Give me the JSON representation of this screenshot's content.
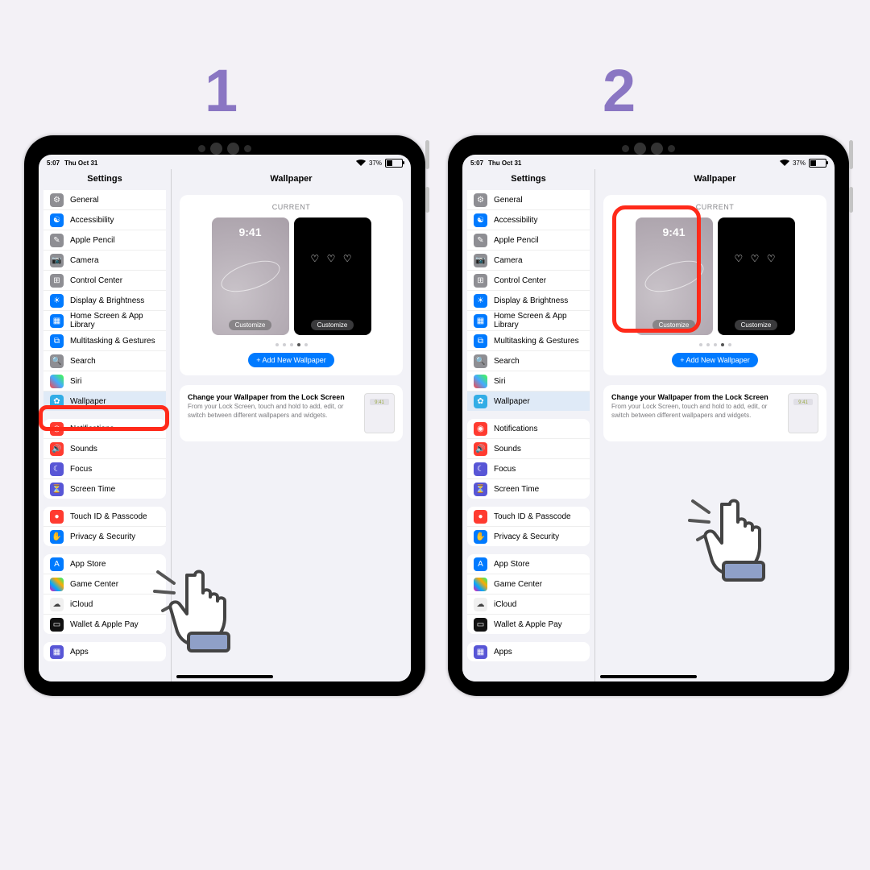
{
  "steps": {
    "one": "1",
    "two": "2"
  },
  "status": {
    "time": "5:07",
    "date": "Thu Oct 31",
    "battery": "37%"
  },
  "sidebar_title": "Settings",
  "detail_title": "Wallpaper",
  "current_label": "CURRENT",
  "preview_time": "9:41",
  "hearts": "♡ ♡ ♡",
  "customize": "Customize",
  "add_new": "+ Add New Wallpaper",
  "tip": {
    "title": "Change your Wallpaper from the Lock Screen",
    "body": "From your Lock Screen, touch and hold to add, edit, or switch between different wallpapers and widgets.",
    "thumb_time": "9:41"
  },
  "groups": [
    {
      "cls": "r0",
      "rows": [
        {
          "icon": "ic-gray",
          "glyph": "⚙",
          "label": "General",
          "name": "sidebar-item-general"
        },
        {
          "icon": "ic-blue",
          "glyph": "☯",
          "label": "Accessibility",
          "name": "sidebar-item-accessibility"
        },
        {
          "icon": "ic-gray",
          "glyph": "✎",
          "label": "Apple Pencil",
          "name": "sidebar-item-apple-pencil"
        },
        {
          "icon": "ic-gray",
          "glyph": "📷",
          "label": "Camera",
          "name": "sidebar-item-camera"
        },
        {
          "icon": "ic-gray",
          "glyph": "⊞",
          "label": "Control Center",
          "name": "sidebar-item-control-center"
        },
        {
          "icon": "ic-blue",
          "glyph": "☀",
          "label": "Display & Brightness",
          "name": "sidebar-item-display"
        },
        {
          "icon": "ic-blue",
          "glyph": "▦",
          "label": "Home Screen & App Library",
          "name": "sidebar-item-home-screen"
        },
        {
          "icon": "ic-blue",
          "glyph": "⧉",
          "label": "Multitasking & Gestures",
          "name": "sidebar-item-multitasking"
        },
        {
          "icon": "ic-gray",
          "glyph": "🔍",
          "label": "Search",
          "name": "sidebar-item-search"
        },
        {
          "icon": "ic-rainbow",
          "glyph": "",
          "label": "Siri",
          "name": "sidebar-item-siri"
        },
        {
          "icon": "ic-cyan",
          "glyph": "✿",
          "label": "Wallpaper",
          "name": "sidebar-item-wallpaper",
          "sel": true
        }
      ]
    },
    {
      "rows": [
        {
          "icon": "ic-red",
          "glyph": "◉",
          "label": "Notifications",
          "name": "sidebar-item-notifications"
        },
        {
          "icon": "ic-red",
          "glyph": "🔊",
          "label": "Sounds",
          "name": "sidebar-item-sounds"
        },
        {
          "icon": "ic-purple",
          "glyph": "☾",
          "label": "Focus",
          "name": "sidebar-item-focus"
        },
        {
          "icon": "ic-purple",
          "glyph": "⏳",
          "label": "Screen Time",
          "name": "sidebar-item-screen-time"
        }
      ]
    },
    {
      "rows": [
        {
          "icon": "ic-red",
          "glyph": "●",
          "label": "Touch ID & Passcode",
          "name": "sidebar-item-touchid"
        },
        {
          "icon": "ic-blue",
          "glyph": "✋",
          "label": "Privacy & Security",
          "name": "sidebar-item-privacy"
        }
      ]
    },
    {
      "rows": [
        {
          "icon": "ic-blue",
          "glyph": "A",
          "label": "App Store",
          "name": "sidebar-item-appstore"
        },
        {
          "icon": "ic-gc",
          "glyph": "",
          "label": "Game Center",
          "name": "sidebar-item-gamecenter"
        },
        {
          "icon": "ic-white",
          "glyph": "☁",
          "label": "iCloud",
          "name": "sidebar-item-icloud"
        },
        {
          "icon": "ic-black",
          "glyph": "▭",
          "label": "Wallet & Apple Pay",
          "name": "sidebar-item-wallet"
        }
      ]
    },
    {
      "rows": [
        {
          "icon": "ic-purple",
          "glyph": "▦",
          "label": "Apps",
          "name": "sidebar-item-apps"
        }
      ]
    }
  ]
}
